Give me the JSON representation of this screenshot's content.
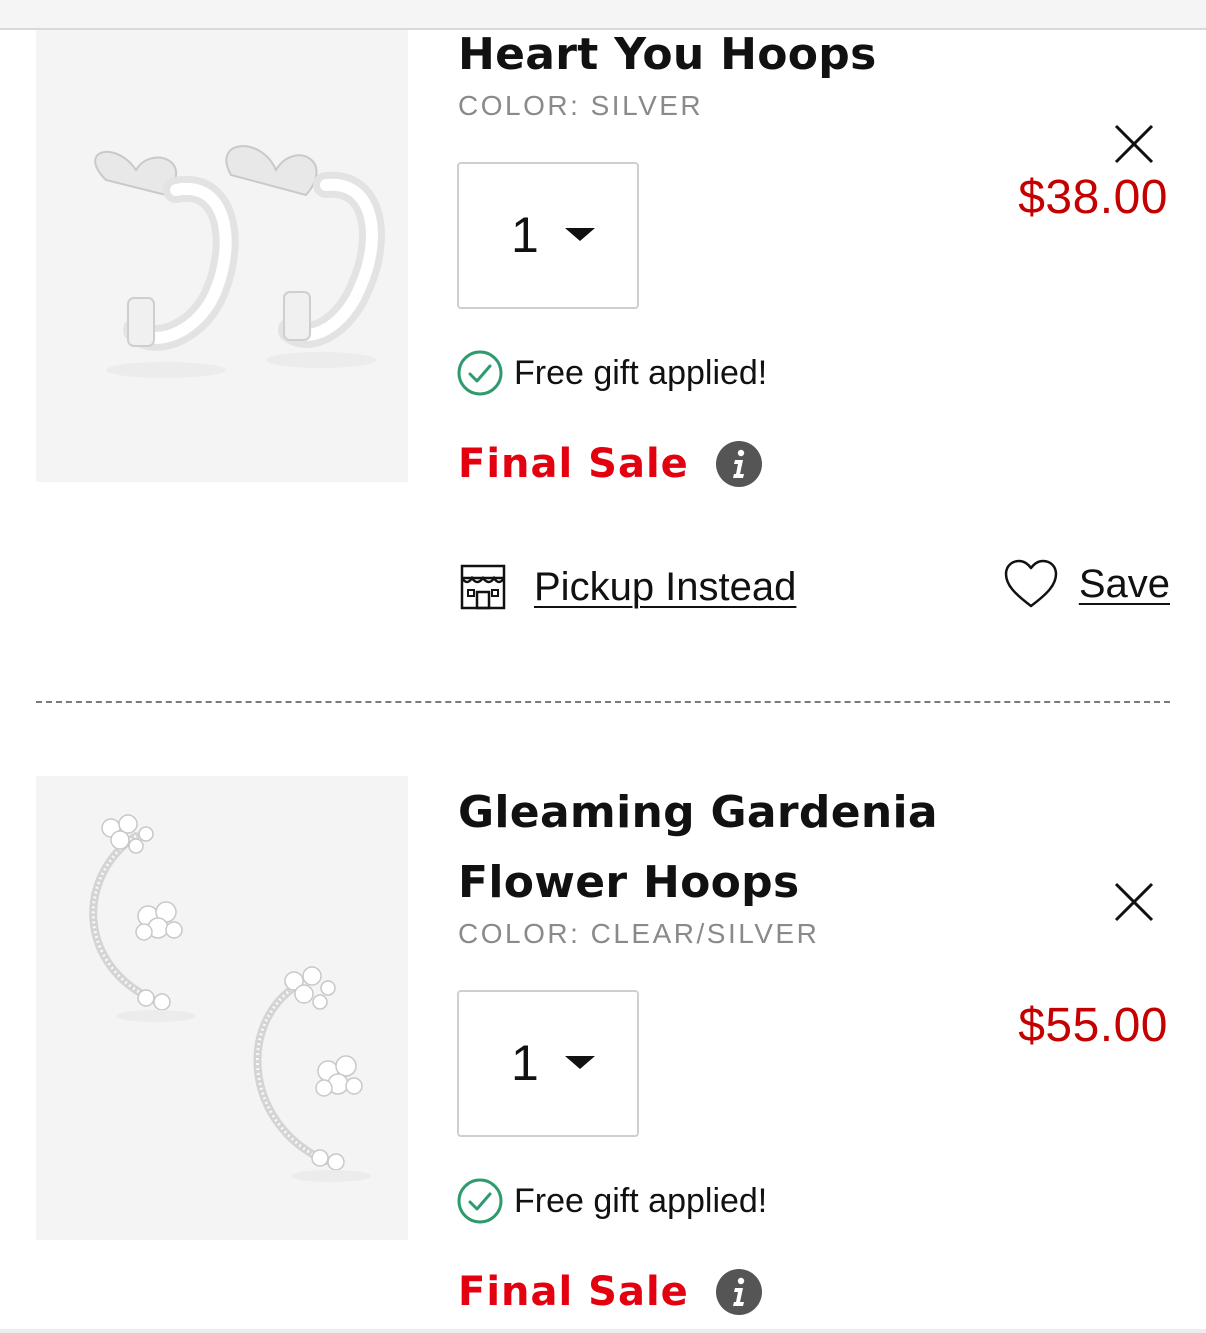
{
  "cart": {
    "items": [
      {
        "title": "Heart You Hoops",
        "color": "COLOR: SILVER",
        "price": "$38.00",
        "quantity": "1",
        "gift_text": "Free gift applied!",
        "final_sale": "Final Sale",
        "pickup_label": "Pickup Instead",
        "save_label": "Save",
        "image_icon": "heart-hoop-earrings-image"
      },
      {
        "title": "Gleaming Gardenia Flower Hoops",
        "color": "COLOR: CLEAR/SILVER",
        "price": "$55.00",
        "quantity": "1",
        "gift_text": "Free gift applied!",
        "final_sale": "Final Sale",
        "image_icon": "flower-hoop-earrings-image"
      }
    ]
  },
  "icons": {
    "remove": "close-icon",
    "quantity_caret": "caret-down-icon",
    "gift_check": "check-circle-icon",
    "info": "info-icon",
    "store": "store-icon",
    "save": "heart-outline-icon"
  },
  "colors": {
    "price": "#c40000",
    "final_sale": "#e3000f",
    "check": "#2e9b6f",
    "info_badge": "#555555",
    "color_label": "#8a8a8a"
  }
}
